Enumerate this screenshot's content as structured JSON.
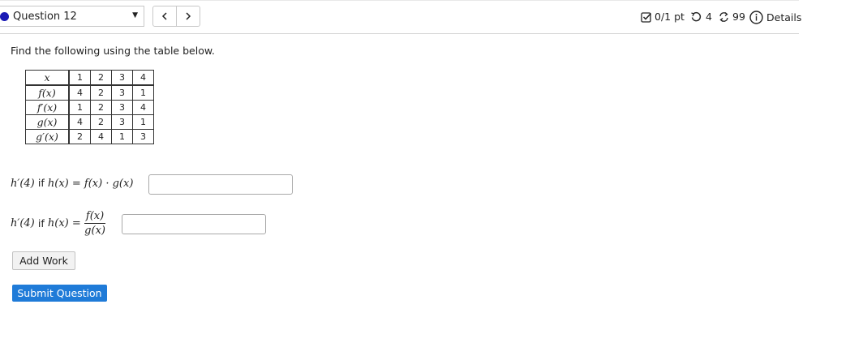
{
  "header": {
    "question_label": "Question 12",
    "score": "0/1 pt",
    "retries": "4",
    "submissions": "99",
    "details_label": "Details",
    "accent_color": "#1a1ab5"
  },
  "body": {
    "prompt": "Find the following using the table below."
  },
  "table": {
    "rows": [
      {
        "label": "x",
        "values": [
          "1",
          "2",
          "3",
          "4"
        ]
      },
      {
        "label": "f(x)",
        "values": [
          "4",
          "2",
          "3",
          "1"
        ]
      },
      {
        "label": "f′(x)",
        "values": [
          "1",
          "2",
          "3",
          "4"
        ]
      },
      {
        "label": "g(x)",
        "values": [
          "4",
          "2",
          "3",
          "1"
        ]
      },
      {
        "label": "g′(x)",
        "values": [
          "2",
          "4",
          "1",
          "3"
        ]
      }
    ]
  },
  "q1": {
    "lhs": "h′(4)",
    "if": "if",
    "rhs": "h(x) = f(x) · g(x)",
    "answer": ""
  },
  "q2": {
    "lhs": "h′(4)",
    "if": "if",
    "rhs": "h(x) =",
    "num": "f(x)",
    "den": "g(x)",
    "answer": ""
  },
  "buttons": {
    "add_work": "Add Work",
    "submit": "Submit Question",
    "submit_color": "#1f7bd8"
  }
}
